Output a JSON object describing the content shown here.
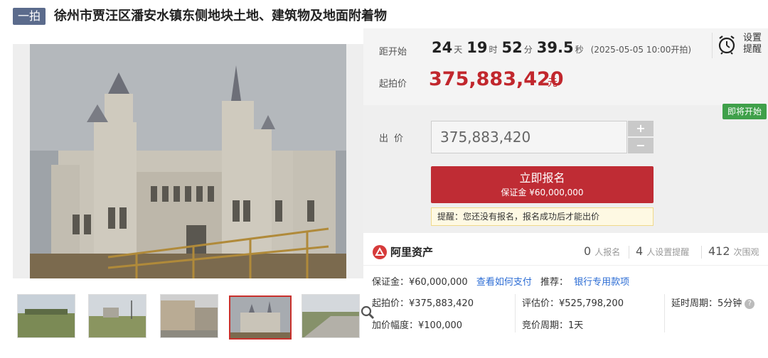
{
  "header": {
    "tag": "一拍",
    "title": "徐州市贾汪区潘安水镇东侧地块土地、建筑物及地面附着物"
  },
  "countdown": {
    "label": "距开始",
    "days": "24",
    "days_unit": "天",
    "hours": "19",
    "hours_unit": "时",
    "minutes": "52",
    "minutes_unit": "分",
    "seconds": "39.5",
    "seconds_unit": "秒",
    "start_time": "(2025-05-05 10:00开拍)",
    "reminder_label": "设置提醒",
    "reminder_icon": "alarm-clock-icon"
  },
  "price": {
    "label": "起拍价",
    "value": "375,883,420",
    "unit": "元"
  },
  "bid": {
    "status_badge": "即将开始",
    "label": "出价",
    "input_value": "375,883,420",
    "plus": "+",
    "minus": "−",
    "register_label": "立即报名",
    "deposit_line": "保证金 ¥60,000,000",
    "tip": "提醒：您还没有报名，报名成功后才能出价"
  },
  "stats": {
    "platform": "阿里资产",
    "registered_count": "0",
    "registered_label": "人报名",
    "reminder_count": "4",
    "reminder_label": "人设置提醒",
    "views_count": "412",
    "views_label": "次围观"
  },
  "info": {
    "deposit": "保证金：¥60,000,000",
    "how_to_pay": "查看如何支付",
    "recommend_label": "推荐：",
    "recommend_link": "银行专用款项",
    "start_price": "起拍价：¥375,883,420",
    "appraisal": "评估价：¥525,798,200",
    "delay": "延时周期：5分钟",
    "increment": "加价幅度：¥100,000",
    "cycle": "竞价周期：1天",
    "help": "?"
  },
  "colors": {
    "accent_red": "#bf2c34",
    "price_red": "#c1272d",
    "link_blue": "#2b6cd4",
    "badge_green": "#3fa04a",
    "tag_gray_blue": "#5b6b8c"
  }
}
